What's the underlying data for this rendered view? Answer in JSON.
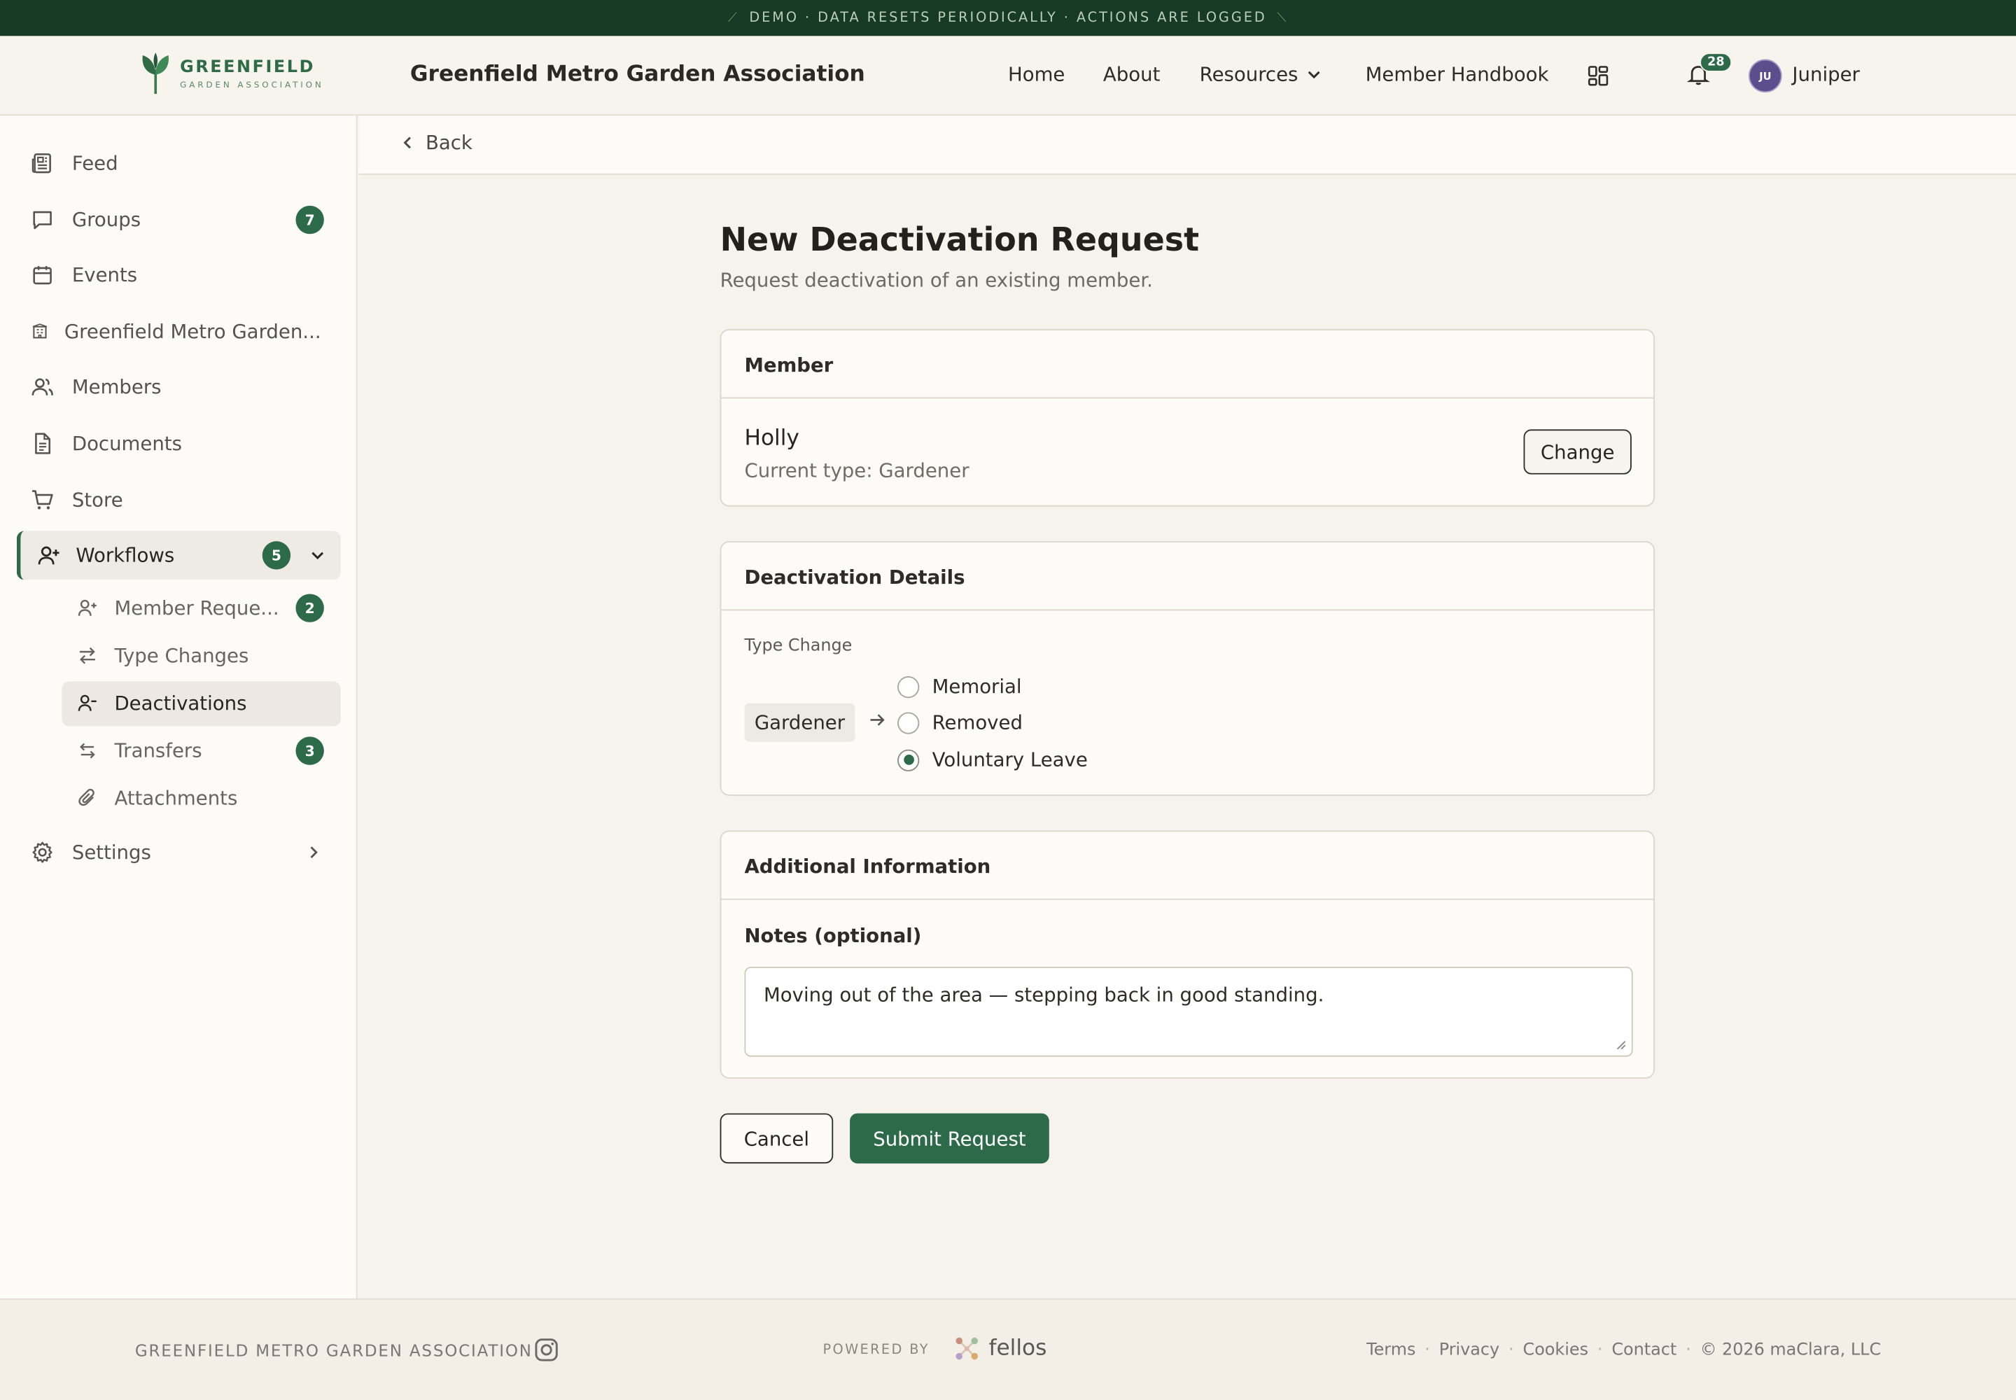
{
  "banner": {
    "text": "DEMO · DATA RESETS PERIODICALLY · ACTIONS ARE LOGGED"
  },
  "header": {
    "logo_name": "GREENFIELD",
    "logo_sub": "GARDEN ASSOCIATION",
    "org_title": "Greenfield Metro Garden Association",
    "nav": {
      "home": "Home",
      "about": "About",
      "resources": "Resources",
      "handbook": "Member Handbook"
    },
    "notifications_count": "28",
    "user_initials": "JU",
    "user_name": "Juniper"
  },
  "sidebar": {
    "items": [
      {
        "label": "Feed"
      },
      {
        "label": "Groups",
        "badge": "7"
      },
      {
        "label": "Events"
      },
      {
        "label": "Greenfield Metro Garden..."
      },
      {
        "label": "Members"
      },
      {
        "label": "Documents"
      },
      {
        "label": "Store"
      }
    ],
    "workflows": {
      "label": "Workflows",
      "badge": "5"
    },
    "sub_items": [
      {
        "label": "Member Reque...",
        "badge": "2"
      },
      {
        "label": "Type Changes"
      },
      {
        "label": "Deactivations"
      },
      {
        "label": "Transfers",
        "badge": "3"
      },
      {
        "label": "Attachments"
      }
    ],
    "settings": {
      "label": "Settings"
    }
  },
  "backbar": {
    "label": "Back"
  },
  "main": {
    "title": "New Deactivation Request",
    "subtitle": "Request deactivation of an existing member.",
    "member_card": {
      "heading": "Member",
      "name": "Holly",
      "current_type": "Current type: Gardener",
      "change_label": "Change"
    },
    "details_card": {
      "heading": "Deactivation Details",
      "type_change_label": "Type Change",
      "from_type": "Gardener",
      "options": [
        "Memorial",
        "Removed",
        "Voluntary Leave"
      ],
      "selected": "Voluntary Leave"
    },
    "info_card": {
      "heading": "Additional Information",
      "notes_label": "Notes (optional)",
      "notes_value": "Moving out of the area — stepping back in good standing."
    },
    "cancel_label": "Cancel",
    "submit_label": "Submit Request"
  },
  "footer": {
    "org": "GREENFIELD METRO GARDEN ASSOCIATION",
    "powered_by": "POWERED BY",
    "brand": "fellos",
    "links": [
      "Terms",
      "Privacy",
      "Cookies",
      "Contact"
    ],
    "copyright": "© 2026 maClara, LLC"
  },
  "colors": {
    "accent": "#2d6a4a",
    "banner_bg": "#173a24",
    "avatar_bg": "#5a4f8c"
  }
}
